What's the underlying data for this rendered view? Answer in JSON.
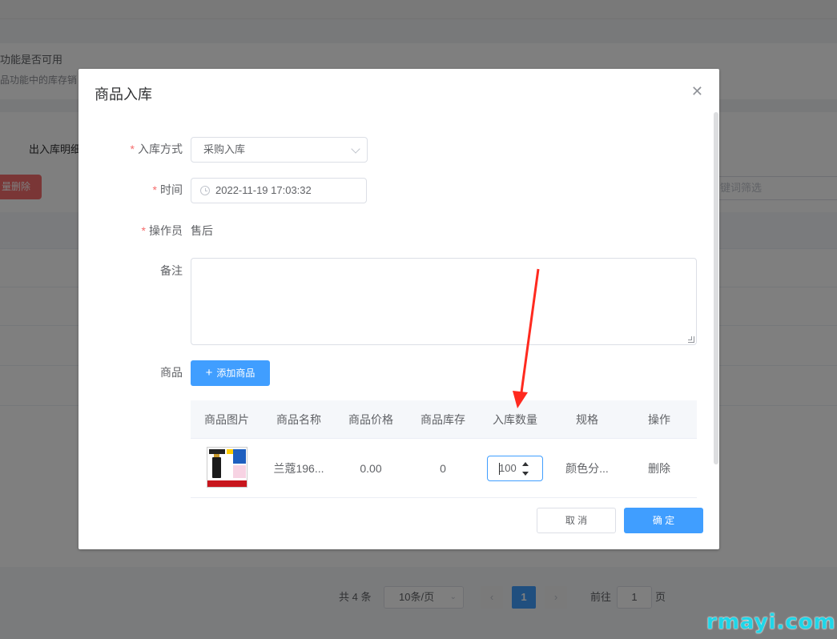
{
  "background": {
    "text_line1": "功能是否可用",
    "text_line2": "品功能中的库存销",
    "tab_label": "出入库明细",
    "batch_delete": "量删除",
    "search_placeholder": "键词筛选",
    "pagination": {
      "total": "共 4 条",
      "page_size": "10条/页",
      "current_page": "1",
      "goto_label": "前往",
      "goto_value": "1",
      "page_unit": "页"
    }
  },
  "dialog": {
    "title": "商品入库",
    "close_icon": "close-icon",
    "form": {
      "method_label": "入库方式",
      "method_value": "采购入库",
      "time_label": "时间",
      "time_value": "2022-11-19 17:03:32",
      "operator_label": "操作员",
      "operator_value": "售后",
      "remark_label": "备注",
      "remark_value": "",
      "goods_label": "商品",
      "add_goods_label": "添加商品"
    },
    "goods_table": {
      "columns": [
        "商品图片",
        "商品名称",
        "商品价格",
        "商品库存",
        "入库数量",
        "规格",
        "操作"
      ],
      "rows": [
        {
          "name": "兰蔻196...",
          "price": "0.00",
          "stock": "0",
          "quantity": "100",
          "spec": "颜色分...",
          "action": "删除"
        }
      ]
    },
    "footer": {
      "cancel_label": "取 消",
      "confirm_label": "确 定"
    }
  },
  "watermark": "rmayi.com",
  "colors": {
    "primary": "#409eff",
    "danger": "#f56c6c",
    "annotation_arrow": "#ff2a1f"
  }
}
